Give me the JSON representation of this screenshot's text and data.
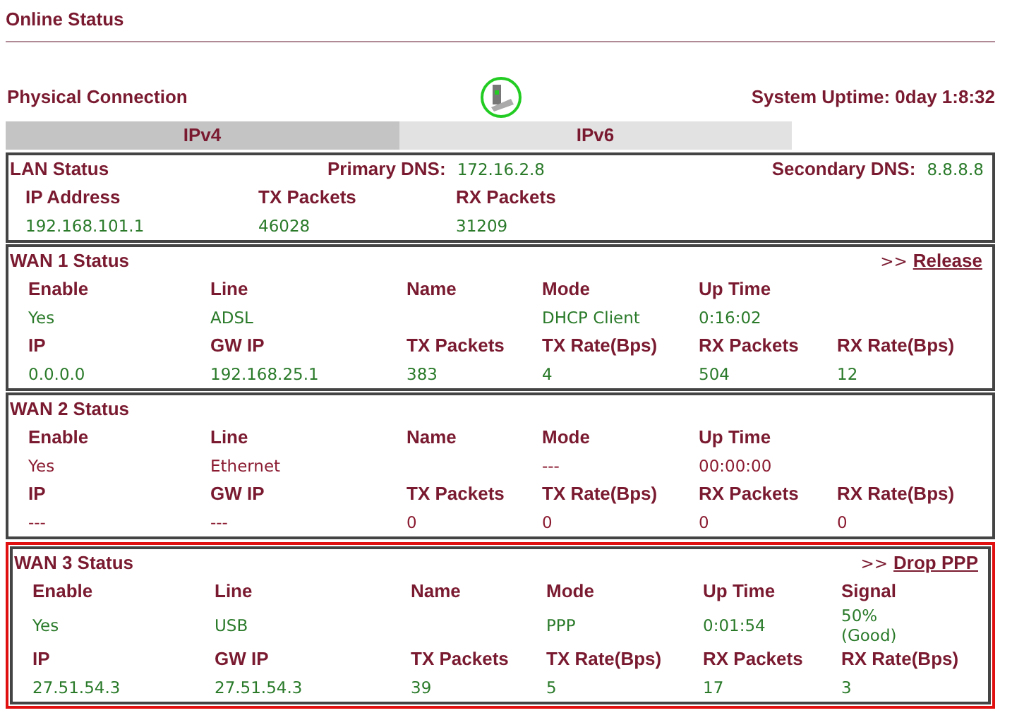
{
  "page_title": "Online Status",
  "physical_connection": {
    "label": "Physical Connection",
    "uptime": "System Uptime: 0day 1:8:32"
  },
  "tabs": [
    {
      "label": "IPv4",
      "selected": true
    },
    {
      "label": "IPv6",
      "selected": false
    }
  ],
  "lan": {
    "title": "LAN Status",
    "primary_dns_label": "Primary DNS:",
    "primary_dns": "172.16.2.8",
    "secondary_dns_label": "Secondary DNS:",
    "secondary_dns": "8.8.8.8",
    "headers": [
      "IP Address",
      "TX Packets",
      "RX Packets"
    ],
    "values": [
      "192.168.101.1",
      "46028",
      "31209"
    ]
  },
  "wans": [
    {
      "title": "WAN 1 Status",
      "action": "Release",
      "action_prefix": ">>",
      "connected": true,
      "highlighted": false,
      "row1": [
        {
          "header": "Enable",
          "value": "Yes"
        },
        {
          "header": "Line",
          "value": "ADSL"
        },
        {
          "header": "Name"
        },
        {
          "header": "Mode",
          "value": "DHCP Client"
        },
        {
          "header": "Up Time",
          "value": "0:16:02"
        }
      ],
      "row2": [
        {
          "header": "IP",
          "value": "0.0.0.0"
        },
        {
          "header": "GW IP",
          "value": "192.168.25.1"
        },
        {
          "header": "TX Packets",
          "value": "383"
        },
        {
          "header": "TX Rate(Bps)",
          "value": "4"
        },
        {
          "header": "RX Packets",
          "value": "504"
        },
        {
          "header": "RX Rate(Bps)",
          "value": "12"
        }
      ]
    },
    {
      "title": "WAN 2 Status",
      "connected": false,
      "highlighted": false,
      "row1": [
        {
          "header": "Enable",
          "value": "Yes"
        },
        {
          "header": "Line",
          "value": "Ethernet"
        },
        {
          "header": "Name"
        },
        {
          "header": "Mode",
          "value": "---"
        },
        {
          "header": "Up Time",
          "value": "00:00:00"
        }
      ],
      "row2": [
        {
          "header": "IP",
          "value": "---"
        },
        {
          "header": "GW IP",
          "value": "---"
        },
        {
          "header": "TX Packets",
          "value": "0"
        },
        {
          "header": "TX Rate(Bps)",
          "value": "0"
        },
        {
          "header": "RX Packets",
          "value": "0"
        },
        {
          "header": "RX Rate(Bps)",
          "value": "0"
        }
      ]
    },
    {
      "title": "WAN 3 Status",
      "action": "Drop PPP",
      "action_prefix": ">>",
      "connected": true,
      "highlighted": true,
      "row1": [
        {
          "header": "Enable",
          "value": " Yes"
        },
        {
          "header": "Line",
          "value": "USB"
        },
        {
          "header": "Name"
        },
        {
          "header": "Mode",
          "value": "PPP"
        },
        {
          "header": "Up Time",
          "value": "0:01:54"
        },
        {
          "header": "Signal",
          "value": "50%\n(Good)"
        }
      ],
      "row2": [
        {
          "header": "IP",
          "value": "27.51.54.3"
        },
        {
          "header": "GW IP",
          "value": "27.51.54.3"
        },
        {
          "header": "TX Packets",
          "value": "39"
        },
        {
          "header": "TX Rate(Bps)",
          "value": "5"
        },
        {
          "header": "RX Packets",
          "value": "17"
        },
        {
          "header": "RX Rate(Bps)",
          "value": "3"
        }
      ]
    }
  ]
}
